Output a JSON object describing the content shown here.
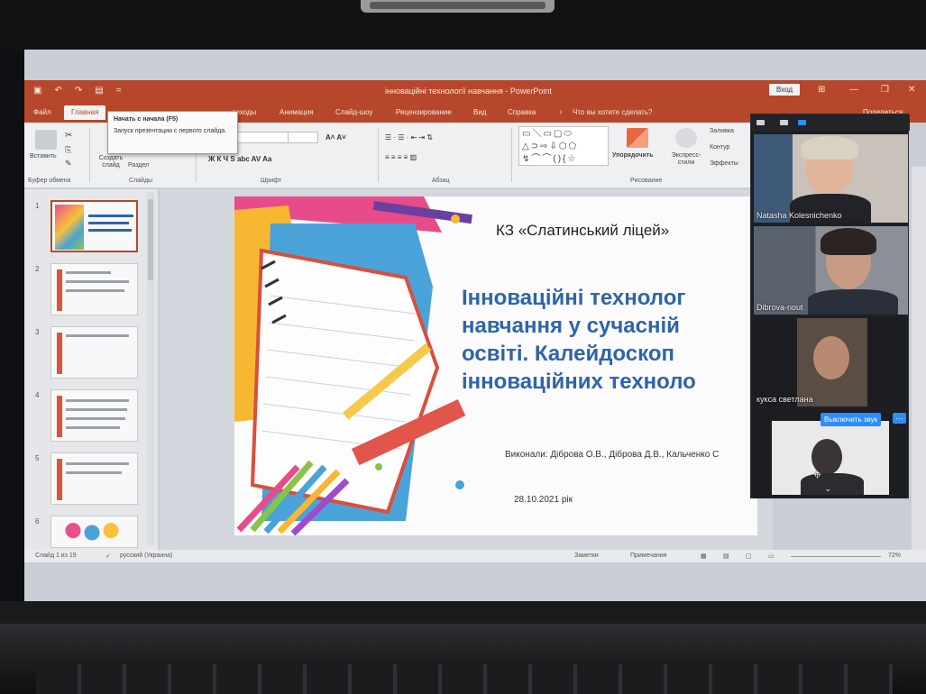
{
  "app": {
    "window_title": "інноваційні технології навчання  -  PowerPoint",
    "sign_in": "Вход",
    "share": "Поделиться",
    "search_hint": "Что вы хотите сделать?"
  },
  "tabs": [
    "Файл",
    "Главная",
    "Вставка",
    "Конструктор",
    "Переходы",
    "Анимация",
    "Слайд-шоу",
    "Рецензирование",
    "Вид",
    "Справка"
  ],
  "tab_visible": {
    "transitions_fragment": "реходы"
  },
  "ribbon": {
    "paste": "Вставить",
    "new_slide": "Создать слайд",
    "section": "Раздел",
    "groups": {
      "clipboard": "Буфер обмена",
      "slides": "Слайды",
      "font": "Шрифт",
      "paragraph": "Абзац",
      "drawing": "Рисование"
    },
    "arrange": "Упорядочить",
    "quick_styles": "Экспресс-стили",
    "fill": "Заливка",
    "outline": "Контур",
    "effects": "Эффекты",
    "font_buttons": "Ж  К  Ч  S  abc  AV  Aa",
    "font_size_btns": "A˄  A˅"
  },
  "tooltip": {
    "title": "Начать с начала (F5)",
    "body": "Запуск презентации с первого слайда."
  },
  "thumbnails": [
    "1",
    "2",
    "3",
    "4",
    "5",
    "6"
  ],
  "slide": {
    "school": "КЗ «Слатинський ліцей»",
    "title": "Інноваційні технолог\nнавчання у сучасній\nосвіті. Калейдоскоп\nінноваційних техноло",
    "authors": "Виконали: Діброва О.В., Діброва Д.В., Кальченко С",
    "date": "28.10.2021 рік"
  },
  "status": {
    "slide_info": "Слайд 1 из 19",
    "language": "русский (Украина)",
    "notes": "Заметки",
    "comments": "Примечания",
    "zoom": "72%"
  },
  "zoom_panel": {
    "participants": [
      {
        "name": "Natasha Kolesnichenko"
      },
      {
        "name": "Dibrova-nout"
      },
      {
        "name": "кукса светлана"
      },
      {
        "name": ""
      }
    ],
    "mute_button": "Выключить звук",
    "more_button": "···"
  },
  "colors": {
    "ppt_red": "#b7472a",
    "title_blue": "#2e64ad",
    "zoom_blue": "#2d8cff"
  }
}
